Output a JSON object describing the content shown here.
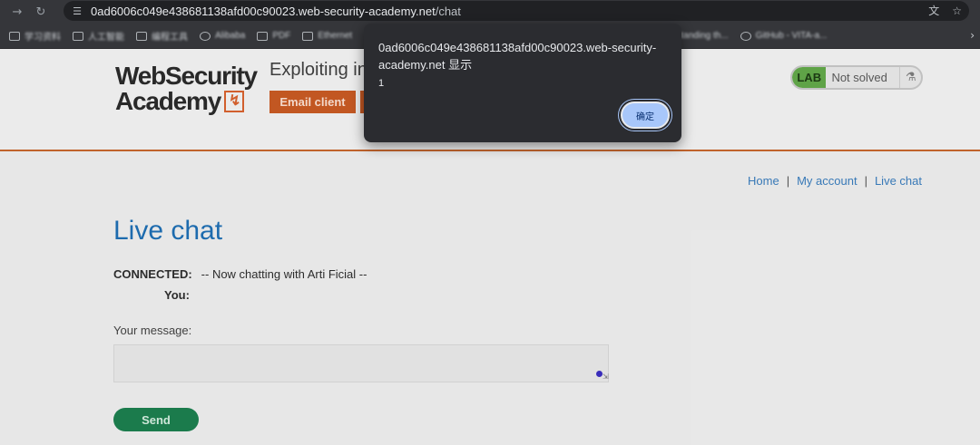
{
  "browser": {
    "url_host": "0ad6006c049e438681138afd00c90023.web-security-academy.net",
    "url_path": "/chat",
    "bookmarks": [
      "学习资料",
      "人工智能",
      "编程工具",
      "Alibaba",
      "PDF",
      "Ethernet",
      "Understanding th...",
      "GitHub - VITA-a..."
    ],
    "icons": {
      "back": "back-arrow-icon",
      "reload": "reload-icon",
      "site_info": "tune-icon",
      "translate": "translate-icon",
      "bookmark": "star-icon",
      "more": "chevron-right-icon"
    }
  },
  "header": {
    "logo_line1": "WebSecurity",
    "logo_line2": "Academy",
    "lab_title": "Exploiting ins",
    "email_button": "Email client",
    "lab_badge": "LAB",
    "lab_status": "Not solved"
  },
  "nav": {
    "home": "Home",
    "sep": "|",
    "account": "My account",
    "chat": "Live chat"
  },
  "chat": {
    "title": "Live chat",
    "connected_label": "CONNECTED:",
    "connected_msg": "-- Now chatting with Arti Ficial --",
    "you_label": "You:",
    "message_label": "Your message:",
    "send_label": "Send"
  },
  "dialog": {
    "title": "0ad6006c049e438681138afd00c90023.web-security-academy.net 显示",
    "message": "1",
    "ok_label": "确定"
  },
  "colors": {
    "accent_orange": "#c95a24",
    "link_blue": "#3a7dbd",
    "title_blue": "#1e6fb4",
    "send_green": "#1c7f4f",
    "lab_green": "#63a94a",
    "dialog_button": "#a8c7fa"
  }
}
